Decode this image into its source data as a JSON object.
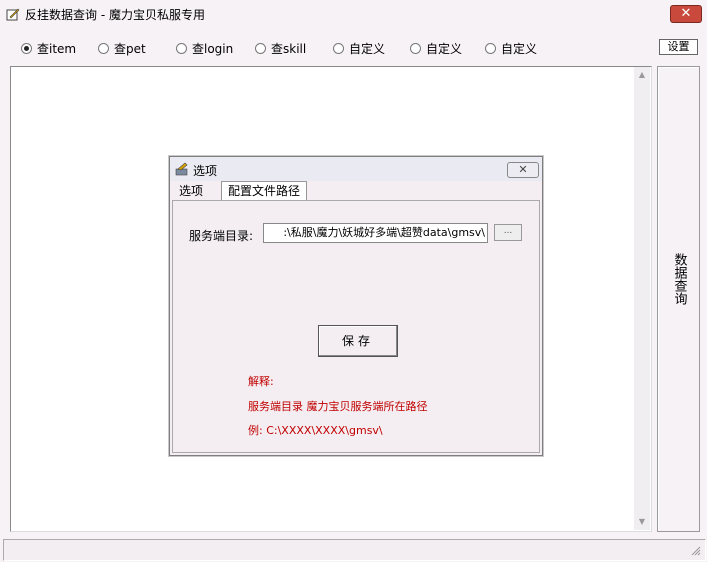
{
  "window": {
    "title": "反挂数据查询 - 魔力宝贝私服专用",
    "close_label": "✕"
  },
  "radios": [
    {
      "label": "查item",
      "selected": true
    },
    {
      "label": "查pet",
      "selected": false
    },
    {
      "label": "查login",
      "selected": false
    },
    {
      "label": "查skill",
      "selected": false
    },
    {
      "label": "自定义",
      "selected": false
    },
    {
      "label": "自定义",
      "selected": false
    },
    {
      "label": "自定义",
      "selected": false
    }
  ],
  "settings_label": "设置",
  "query_label": "数据查询",
  "dialog": {
    "title": "选项",
    "close_label": "✕",
    "tabs": [
      {
        "label": "选项"
      },
      {
        "label": "配置文件路径"
      }
    ],
    "server_dir_label": "服务端目录:",
    "server_dir_value": ":\\私服\\魔力\\妖城好多端\\超赞data\\gmsv\\",
    "browse_label": "...",
    "save_label": "保存",
    "notes": {
      "heading": "解释:",
      "line1": "服务端目录 魔力宝贝服务端所在路径",
      "line2": "例: C:\\XXXX\\XXXX\\gmsv\\"
    }
  }
}
